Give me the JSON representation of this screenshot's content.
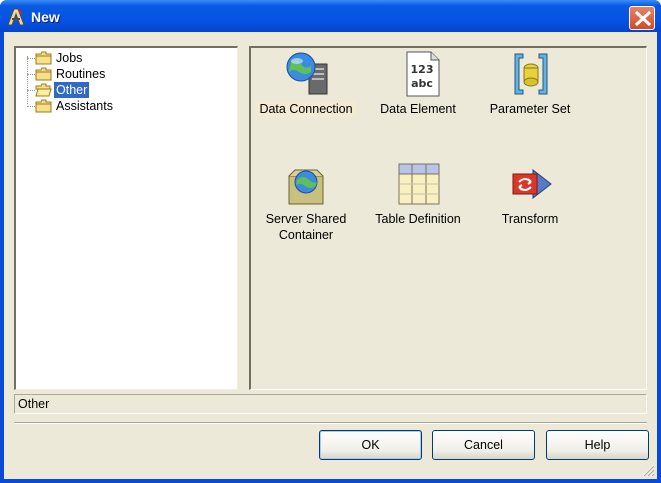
{
  "window": {
    "title": "New"
  },
  "tree": {
    "items": [
      {
        "label": "Jobs",
        "selected": false
      },
      {
        "label": "Routines",
        "selected": false
      },
      {
        "label": "Other",
        "selected": true
      },
      {
        "label": "Assistants",
        "selected": false
      }
    ]
  },
  "icons": [
    {
      "label": "Data Connection",
      "icon": "data-connection-icon",
      "selected": true
    },
    {
      "label": "Data Element",
      "icon": "data-element-icon",
      "glyph_text_top": "123",
      "glyph_text_bottom": "abc",
      "selected": false
    },
    {
      "label": "Parameter Set",
      "icon": "parameter-set-icon",
      "selected": false
    },
    {
      "label_line1": "Server Shared",
      "label_line2": "Container",
      "icon": "server-shared-container-icon",
      "selected": false
    },
    {
      "label": "Table Definition",
      "icon": "table-definition-icon",
      "selected": false
    },
    {
      "label": "Transform",
      "icon": "transform-icon",
      "selected": false
    }
  ],
  "status_text": "Other",
  "buttons": {
    "ok": "OK",
    "cancel": "Cancel",
    "help": "Help"
  },
  "colors": {
    "selection": "#316ac5",
    "titlebar": "#0554e6",
    "face": "#ece9d8"
  }
}
